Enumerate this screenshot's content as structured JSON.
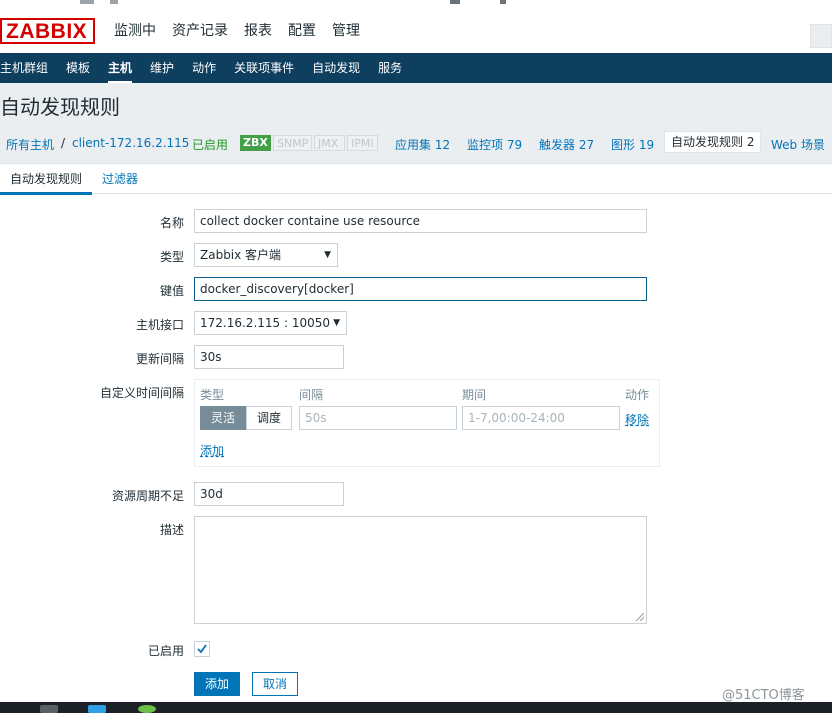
{
  "brand": {
    "logo": "ZABBIX"
  },
  "top_menu": [
    "监测中",
    "资产记录",
    "报表",
    "配置",
    "管理"
  ],
  "sub_menu": [
    "主机群组",
    "模板",
    "主机",
    "维护",
    "动作",
    "关联项事件",
    "自动发现",
    "服务"
  ],
  "page_title": "自动发现规则",
  "breadcrumb": {
    "all_hosts": "所有主机",
    "separator": "/",
    "host": "client-172.16.2.115",
    "status": "已启用",
    "tags": [
      "ZBX",
      "SNMP",
      "JMX",
      "IPMI"
    ],
    "links": [
      "应用集 12",
      "监控项 79",
      "触发器 27",
      "图形 19",
      "自动发现规则 2",
      "Web 场景"
    ]
  },
  "tabs": {
    "main": "自动发现规则",
    "filters": "过滤器"
  },
  "form": {
    "name": {
      "label": "名称",
      "value": "collect docker containe use resource"
    },
    "type": {
      "label": "类型",
      "value": "Zabbix 客户端"
    },
    "key": {
      "label": "键值",
      "value": "docker_discovery[docker]"
    },
    "interface": {
      "label": "主机接口",
      "value": "172.16.2.115 : 10050"
    },
    "interval": {
      "label": "更新间隔",
      "value": "30s"
    },
    "custom_intervals": {
      "label": "自定义时间间隔",
      "headers": {
        "type": "类型",
        "interval": "间隔",
        "period": "期间",
        "action": "动作"
      },
      "mode_flexible": "灵活",
      "mode_scheduling": "调度",
      "interval_placeholder": "50s",
      "period_placeholder": "1-7,00:00-24:00",
      "remove": "移除",
      "add": "添加"
    },
    "lifetime": {
      "label": "资源周期不足",
      "value": "30d"
    },
    "description": {
      "label": "描述",
      "value": ""
    },
    "enabled": {
      "label": "已启用",
      "checked": true
    },
    "buttons": {
      "add": "添加",
      "cancel": "取消"
    }
  },
  "watermark": "@51CTO博客",
  "colors": {
    "accent": "#0275b8",
    "nav": "#0e3f5f",
    "logo": "#d40000",
    "enabled_tag": "#43a047"
  }
}
